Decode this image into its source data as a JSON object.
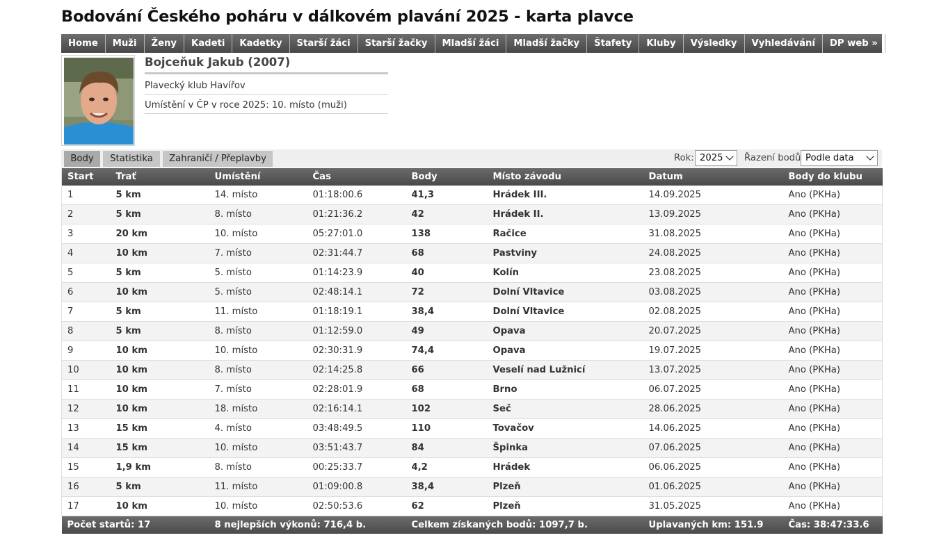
{
  "page": {
    "title": "Bodování Českého poháru v dálkovém plavání 2025 - karta plavce"
  },
  "nav": [
    "Home",
    "Muži",
    "Ženy",
    "Kadeti",
    "Kadetky",
    "Starší žáci",
    "Starší žačky",
    "Mladší žáci",
    "Mladší žačky",
    "Štafety",
    "Kluby",
    "Výsledky",
    "Vyhledávání",
    "DP web »"
  ],
  "swimmer": {
    "name": "Bojceňuk Jakub (2007)",
    "club": "Plavecký klub Havířov",
    "ranking": "Umístění v ČP v roce 2025: 10. místo (muži)"
  },
  "tabs": [
    "Body",
    "Statistika",
    "Zahraničí / Přeplavby"
  ],
  "controls": {
    "year_label": "Rok:",
    "year_value": "2025",
    "sort_label": "Řazení bodů:",
    "sort_value": "Podle data"
  },
  "table": {
    "headers": [
      "Start",
      "Trať",
      "Umístění",
      "Čas",
      "Body",
      "Místo závodu",
      "Datum",
      "Body do klubu"
    ],
    "rows": [
      [
        "1",
        "5 km",
        "14. místo",
        "01:18:00.6",
        "41,3",
        "Hrádek III.",
        "14.09.2025",
        "Ano (PKHa)"
      ],
      [
        "2",
        "5 km",
        "8. místo",
        "01:21:36.2",
        "42",
        "Hrádek II.",
        "13.09.2025",
        "Ano (PKHa)"
      ],
      [
        "3",
        "20 km",
        "10. místo",
        "05:27:01.0",
        "138",
        "Račice",
        "31.08.2025",
        "Ano (PKHa)"
      ],
      [
        "4",
        "10 km",
        "7. místo",
        "02:31:44.7",
        "68",
        "Pastviny",
        "24.08.2025",
        "Ano (PKHa)"
      ],
      [
        "5",
        "5 km",
        "5. místo",
        "01:14:23.9",
        "40",
        "Kolín",
        "23.08.2025",
        "Ano (PKHa)"
      ],
      [
        "6",
        "10 km",
        "5. místo",
        "02:48:14.1",
        "72",
        "Dolní Vltavice",
        "03.08.2025",
        "Ano (PKHa)"
      ],
      [
        "7",
        "5 km",
        "11. místo",
        "01:18:19.1",
        "38,4",
        "Dolní Vltavice",
        "02.08.2025",
        "Ano (PKHa)"
      ],
      [
        "8",
        "5 km",
        "8. místo",
        "01:12:59.0",
        "49",
        "Opava",
        "20.07.2025",
        "Ano (PKHa)"
      ],
      [
        "9",
        "10 km",
        "10. místo",
        "02:30:31.9",
        "74,4",
        "Opava",
        "19.07.2025",
        "Ano (PKHa)"
      ],
      [
        "10",
        "10 km",
        "8. místo",
        "02:14:25.8",
        "66",
        "Veselí nad Lužnicí",
        "13.07.2025",
        "Ano (PKHa)"
      ],
      [
        "11",
        "10 km",
        "7. místo",
        "02:28:01.9",
        "68",
        "Brno",
        "06.07.2025",
        "Ano (PKHa)"
      ],
      [
        "12",
        "10 km",
        "18. místo",
        "02:16:14.1",
        "102",
        "Seč",
        "28.06.2025",
        "Ano (PKHa)"
      ],
      [
        "13",
        "15 km",
        "4. místo",
        "03:48:49.5",
        "110",
        "Tovačov",
        "14.06.2025",
        "Ano (PKHa)"
      ],
      [
        "14",
        "15 km",
        "10. místo",
        "03:51:43.7",
        "84",
        "Špinka",
        "07.06.2025",
        "Ano (PKHa)"
      ],
      [
        "15",
        "1,9 km",
        "8. místo",
        "00:25:33.7",
        "4,2",
        "Hrádek",
        "06.06.2025",
        "Ano (PKHa)"
      ],
      [
        "16",
        "5 km",
        "11. místo",
        "01:09:00.8",
        "38,4",
        "Plzeň",
        "01.06.2025",
        "Ano (PKHa)"
      ],
      [
        "17",
        "10 km",
        "10. místo",
        "02:50:53.6",
        "62",
        "Plzeň",
        "31.05.2025",
        "Ano (PKHa)"
      ]
    ],
    "footer": {
      "starts": "Počet startů: 17",
      "best8": "8 nejlepších výkonů: 716,4 b.",
      "total_points": "Celkem získaných bodů: 1097,7 b.",
      "km": "Uplavaných km: 151.9",
      "time": "Čas: 38:47:33.6"
    }
  }
}
